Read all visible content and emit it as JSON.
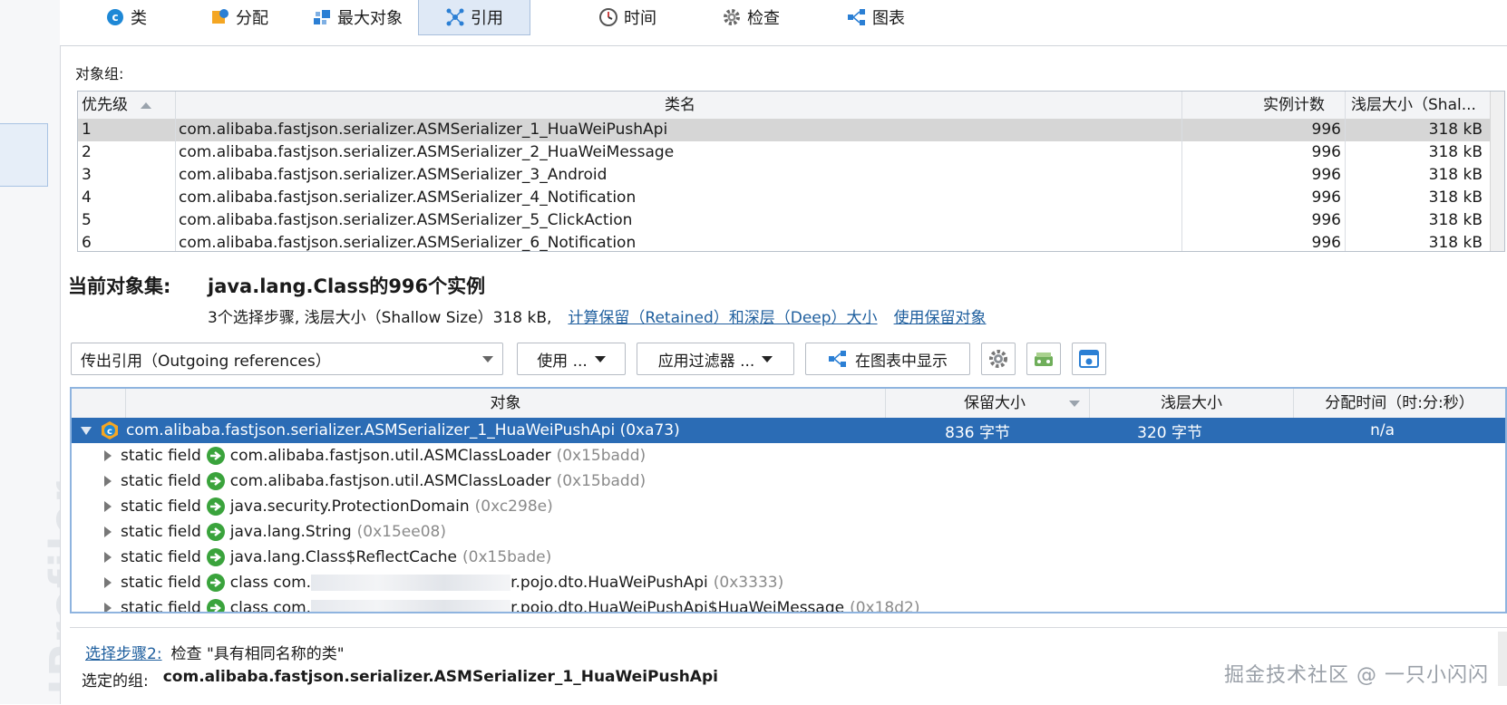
{
  "sidebar": {
    "brand": "JProfiler"
  },
  "tabs": [
    {
      "label": "类",
      "icon": "class-icon"
    },
    {
      "label": "分配",
      "icon": "allocation-icon"
    },
    {
      "label": "最大对象",
      "icon": "biggest-objects-icon"
    },
    {
      "label": "引用",
      "icon": "references-icon",
      "active": true
    },
    {
      "label": "时间",
      "icon": "clock-icon"
    },
    {
      "label": "检查",
      "icon": "gear-icon"
    },
    {
      "label": "图表",
      "icon": "graph-icon"
    }
  ],
  "object_groups": {
    "label": "对象组:",
    "columns": [
      "优先级",
      "类名",
      "实例计数",
      "浅层大小（Shal..."
    ],
    "rows": [
      [
        "1",
        "com.alibaba.fastjson.serializer.ASMSerializer_1_HuaWeiPushApi",
        "996",
        "318 kB"
      ],
      [
        "2",
        "com.alibaba.fastjson.serializer.ASMSerializer_2_HuaWeiMessage",
        "996",
        "318 kB"
      ],
      [
        "3",
        "com.alibaba.fastjson.serializer.ASMSerializer_3_Android",
        "996",
        "318 kB"
      ],
      [
        "4",
        "com.alibaba.fastjson.serializer.ASMSerializer_4_Notification",
        "996",
        "318 kB"
      ],
      [
        "5",
        "com.alibaba.fastjson.serializer.ASMSerializer_5_ClickAction",
        "996",
        "318 kB"
      ],
      [
        "6",
        "com.alibaba.fastjson.serializer.ASMSerializer_6_Notification",
        "996",
        "318 kB"
      ]
    ]
  },
  "current_set": {
    "label": "当前对象集:",
    "value": "java.lang.Class的996个实例",
    "summary": "3个选择步骤, 浅层大小（Shallow Size）318 kB,",
    "link_retained": "计算保留（Retained）和深层（Deep）大小",
    "link_use_retained": "使用保留对象"
  },
  "toolbar": {
    "dropdown": "传出引用（Outgoing references）",
    "use": "使用 ...",
    "filter": "应用过滤器 ...",
    "show_graph": "在图表中显示"
  },
  "tree": {
    "columns": [
      "对象",
      "保留大小",
      "浅层大小",
      "分配时间（时:分:秒）"
    ],
    "root": {
      "label": "com.alibaba.fastjson.serializer.ASMSerializer_1_HuaWeiPushApi (0xa73)",
      "retained": "836 字节",
      "shallow": "320 字节",
      "time": "n/a"
    },
    "children": [
      {
        "prefix": "static field",
        "type": "com.alibaba.fastjson.util.ASMClassLoader",
        "id": "(0x15badd)"
      },
      {
        "prefix": "static field",
        "type": "com.alibaba.fastjson.util.ASMClassLoader",
        "id": "(0x15badd)"
      },
      {
        "prefix": "static field",
        "type": "java.security.ProtectionDomain",
        "id": "(0xc298e)"
      },
      {
        "prefix": "static field",
        "type": "java.lang.String",
        "id": "(0x15ee08)"
      },
      {
        "prefix": "static field",
        "type": "java.lang.Class$ReflectCache",
        "id": "(0x15bade)"
      },
      {
        "prefix": "static field",
        "type": "class com.",
        "type_end": "r.pojo.dto.HuaWeiPushApi",
        "id": "(0x3333)"
      },
      {
        "prefix": "static field",
        "type": "class com.",
        "type_end": "r.pojo.dto.HuaWeiPushApi$HuaWeiMessage",
        "id": "(0x18d2)"
      }
    ]
  },
  "bottom": {
    "step_link": "选择步骤2:",
    "step_text": "检查 \"具有相同名称的类\"",
    "group_label": "选定的组:",
    "group_value": "com.alibaba.fastjson.serializer.ASMSerializer_1_HuaWeiPushApi",
    "watermark": "掘金技术社区 @ 一只小闪闪"
  },
  "colors": {
    "selection": "#2b6cb5",
    "link": "#1f5f9e",
    "accent_border": "#8fb4df",
    "arrow_icon": "#3aa33c"
  }
}
